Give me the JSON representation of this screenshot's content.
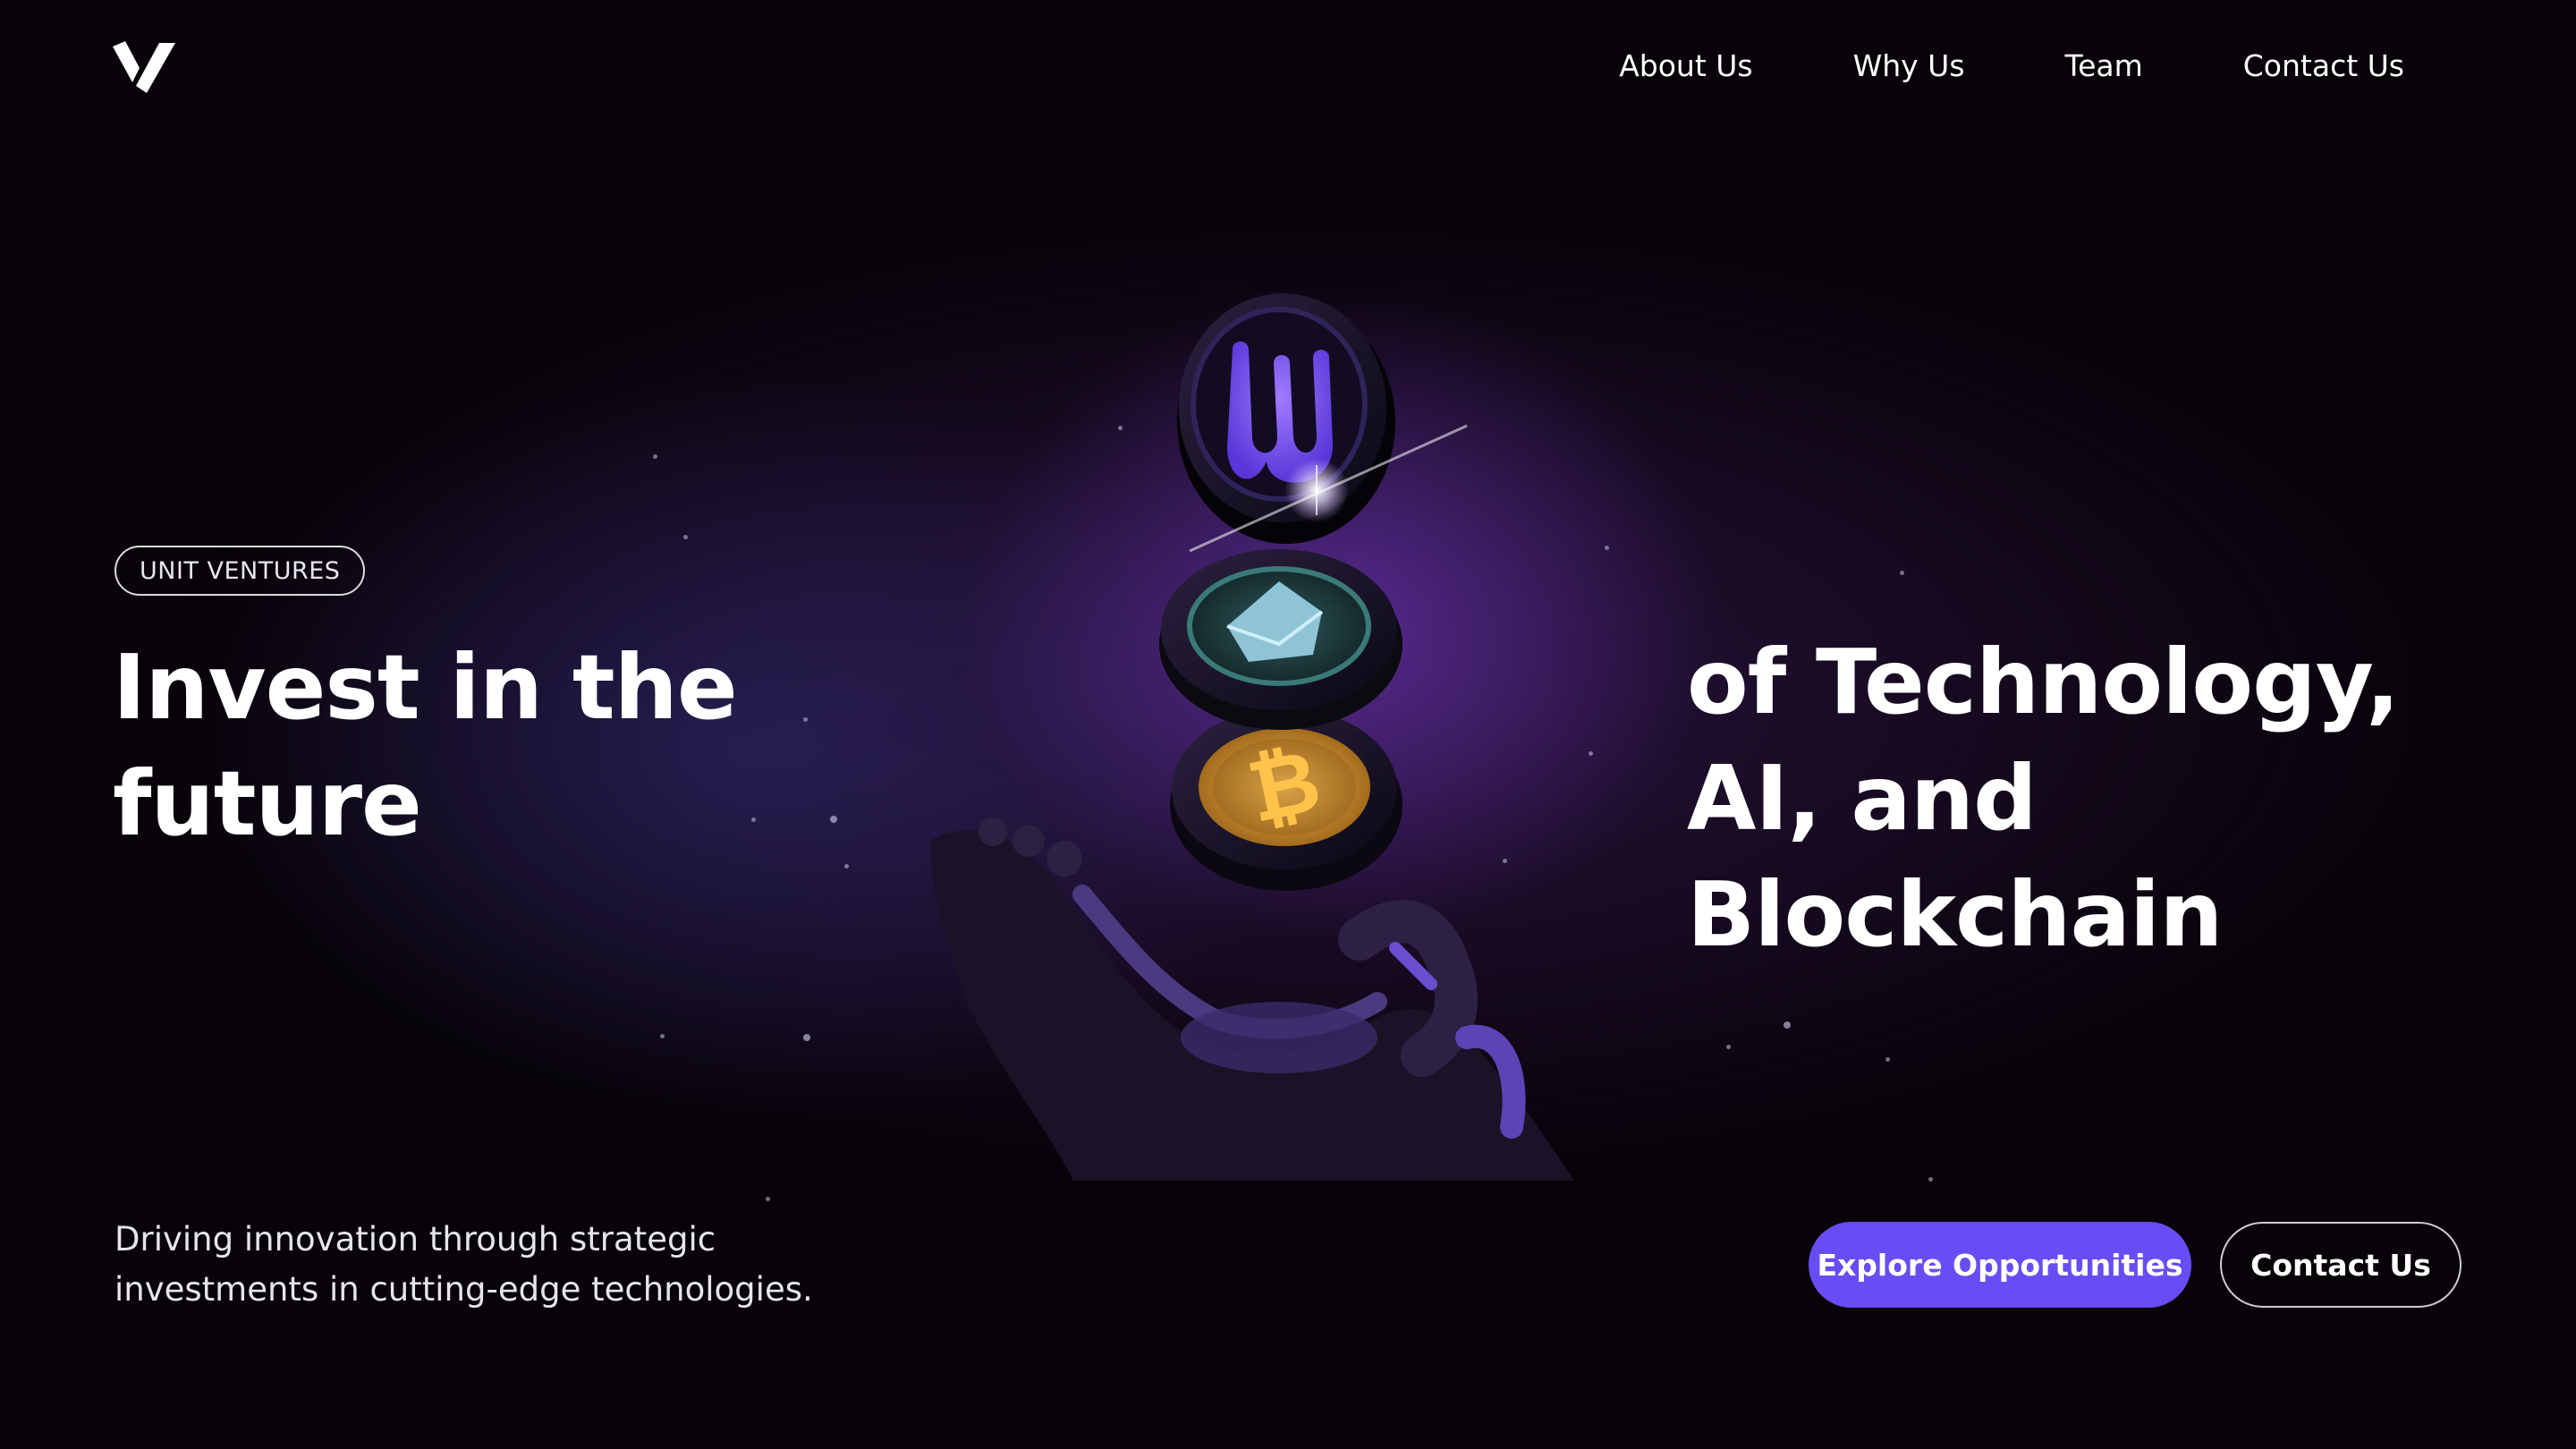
{
  "brand": {
    "logo_icon": "v-checkmark-logo",
    "accent": "#6a4cf5"
  },
  "nav": {
    "items": [
      {
        "label": "About Us"
      },
      {
        "label": "Why Us"
      },
      {
        "label": "Team"
      },
      {
        "label": "Contact Us"
      }
    ]
  },
  "hero": {
    "badge": "UNIT VENTURES",
    "headline_left": "Invest in the future",
    "headline_right": "of Technology, AI, and Blockchain",
    "subtext": "Driving innovation through strategic investments in cutting-edge technologies.",
    "primary_cta": "Explore Opportunities",
    "secondary_cta": "Contact Us",
    "illustration": {
      "icons": [
        "unit-token-icon",
        "envelope-token-icon",
        "bitcoin-token-icon",
        "robot-hand-icon"
      ]
    }
  },
  "colors": {
    "background": "#070308",
    "purple_glow": "#7e3ed6",
    "bitcoin": "#e0a53a",
    "teal": "#3a7a78"
  }
}
